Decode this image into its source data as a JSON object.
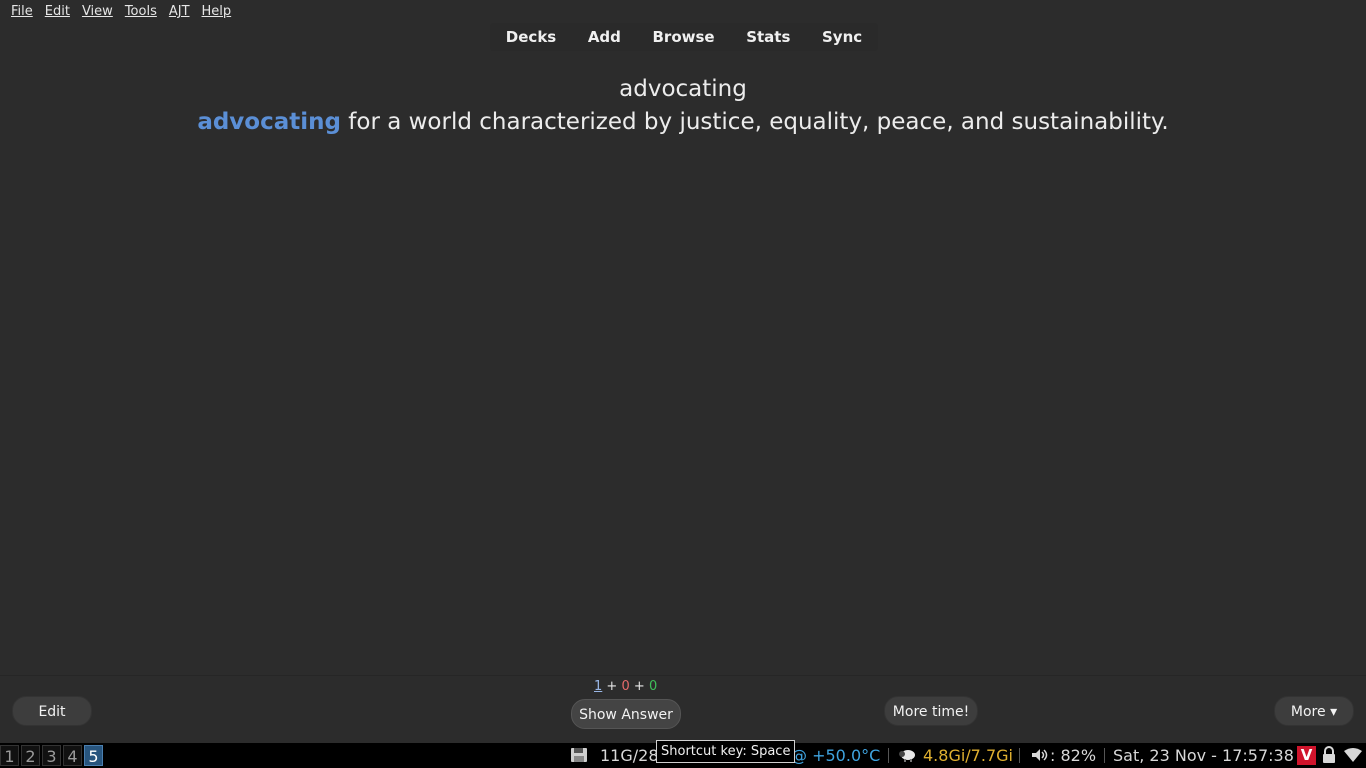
{
  "menu": {
    "file": "File",
    "edit": "Edit",
    "view": "View",
    "tools": "Tools",
    "ajt": "AJT",
    "help": "Help"
  },
  "toolbar": {
    "decks": "Decks",
    "add": "Add",
    "browse": "Browse",
    "stats": "Stats",
    "sync": "Sync"
  },
  "card": {
    "front": "advocating",
    "highlight": "advocating",
    "sentence_rest": "for a world characterized by justice, equality, peace, and sustainability."
  },
  "bottom": {
    "count_new": "1",
    "plus1": "+",
    "count_learn": "0",
    "plus2": "+",
    "count_review": "0",
    "edit_label": "Edit",
    "show_answer_label": "Show Answer",
    "more_time_label": "More time!",
    "more_label": "More ▾"
  },
  "taskbar": {
    "workspaces": [
      "1",
      "2",
      "3",
      "4",
      "5"
    ],
    "active_workspace": "5",
    "disk": "11G/28",
    "tooltip": "Shortcut key: Space",
    "temp": "@ +50.0°C",
    "memory": "4.8Gi/7.7Gi",
    "volume": ": 82%",
    "datetime": "Sat, 23 Nov - 17:57:38",
    "vivaldi_letter": "V"
  },
  "colors": {
    "background": "#2c2c2c",
    "highlight": "#5b8fd6",
    "learn": "#e46a6a",
    "review": "#3fbf5a",
    "temp": "#3fa4e0",
    "memory": "#e0b030",
    "active_workspace": "#28557e"
  },
  "icons": {
    "disk": "floppy-disk-icon",
    "memory": "sheep-icon",
    "volume": "speaker-icon",
    "browser": "vivaldi-icon",
    "lock": "padlock-icon",
    "wifi": "wifi-icon"
  }
}
